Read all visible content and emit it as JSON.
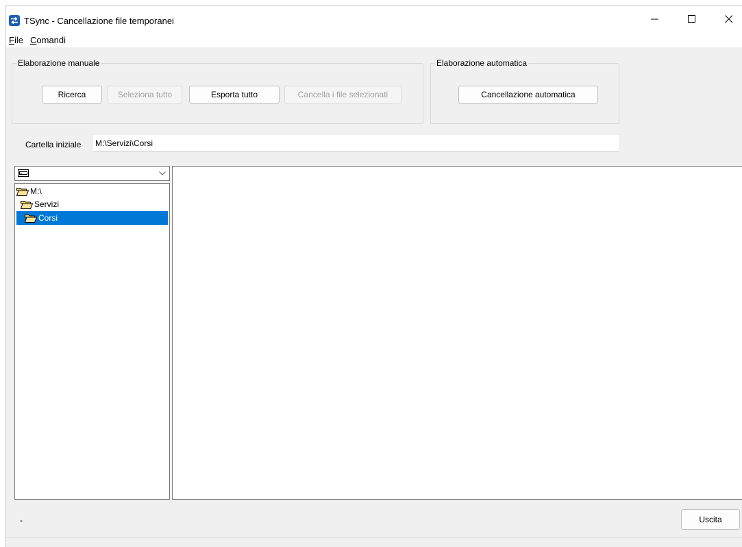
{
  "window": {
    "title": "TSync - Cancellazione file temporanei",
    "controls": {
      "minimize": "—",
      "maximize": "☐",
      "close": "✕"
    }
  },
  "menu": {
    "items": [
      {
        "label": "File",
        "mnemonic": "F",
        "rest": "ile"
      },
      {
        "label": "Comandi",
        "mnemonic": "C",
        "rest": "omandi"
      }
    ]
  },
  "manual": {
    "label": "Elaborazione manuale",
    "buttons": {
      "search": "Ricerca",
      "select_all": "Seleziona tutto",
      "export_all": "Esporta tutto",
      "delete_selected": "Cancella i file selezionati"
    }
  },
  "automatic": {
    "label": "Elaborazione automatica",
    "button": "Cancellazione automatica"
  },
  "start_folder": {
    "label": "Cartella iniziale",
    "value": "M:\\Servizi\\Corsi"
  },
  "drive": {
    "icon": "drive-icon"
  },
  "tree": {
    "items": [
      {
        "label": "M:\\",
        "icon": "folder-open-icon",
        "selected": false
      },
      {
        "label": "Servizi",
        "icon": "folder-open-icon",
        "selected": false
      },
      {
        "label": "Corsi",
        "icon": "folder-open-icon",
        "selected": true
      }
    ]
  },
  "status": {
    "text": "-"
  },
  "footer": {
    "exit_button": "Uscita"
  },
  "colors": {
    "accent": "#0078d7",
    "window_bg": "#f0f0f0",
    "folder": "#f6d36a"
  }
}
